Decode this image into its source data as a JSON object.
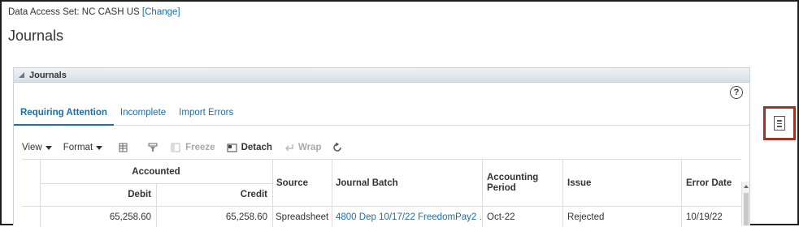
{
  "data_access": {
    "label": "Data Access Set:",
    "value": "NC CASH US",
    "change_label": "[Change]"
  },
  "page_title": "Journals",
  "panel": {
    "title": "Journals",
    "help_label": "?"
  },
  "tabs": [
    {
      "label": "Requiring Attention",
      "active": true
    },
    {
      "label": "Incomplete",
      "active": false
    },
    {
      "label": "Import Errors",
      "active": false
    }
  ],
  "toolbar": {
    "view_label": "View",
    "format_label": "Format",
    "freeze_label": "Freeze",
    "detach_label": "Detach",
    "wrap_label": "Wrap"
  },
  "table": {
    "group_header": "Accounted",
    "columns": {
      "debit": "Debit",
      "credit": "Credit",
      "source": "Source",
      "journal_batch": "Journal Batch",
      "accounting_period": "Accounting Period",
      "issue": "Issue",
      "error_date": "Error Date"
    },
    "rows": [
      {
        "debit": "65,258.60",
        "credit": "65,258.60",
        "source": "Spreadsheet",
        "journal_batch": "4800 Dep 10/17/22 FreedomPay2 …",
        "accounting_period": "Oct-22",
        "issue": "Rejected",
        "error_date": "10/19/22"
      }
    ]
  },
  "colors": {
    "link": "#1d6fa5",
    "highlight_border": "#a13325"
  },
  "icons": {
    "collapse": "triangle-collapse-icon",
    "query_by_example": "query-by-example-icon",
    "filter": "filter-icon",
    "freeze": "freeze-icon",
    "detach": "detach-icon",
    "wrap": "wrap-icon",
    "refresh": "refresh-icon",
    "side_panel": "document-icon"
  }
}
